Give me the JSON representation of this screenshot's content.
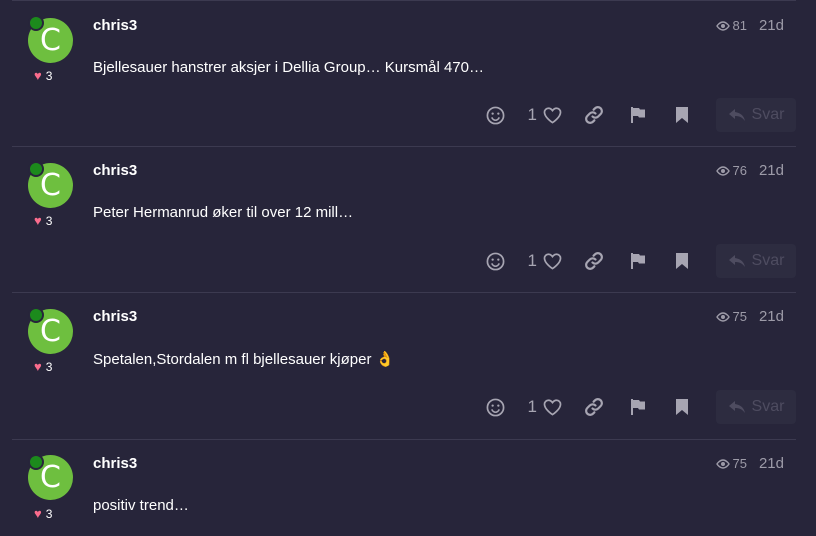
{
  "posts": [
    {
      "avatar_letter": "C",
      "username": "chris3",
      "like_count": "3",
      "views": "81",
      "age": "21d",
      "text": "Bjellesauer hanstrer aksjer i Dellia Group… Kursmål 470…",
      "post_likes": "1",
      "reply_label": "Svar"
    },
    {
      "avatar_letter": "C",
      "username": "chris3",
      "like_count": "3",
      "views": "76",
      "age": "21d",
      "text": "Peter Hermanrud øker til over 12 mill…",
      "post_likes": "1",
      "reply_label": "Svar"
    },
    {
      "avatar_letter": "C",
      "username": "chris3",
      "like_count": "3",
      "views": "75",
      "age": "21d",
      "text": "Spetalen,Stordalen m fl bjellesauer kjøper 👌",
      "post_likes": "1",
      "reply_label": "Svar"
    },
    {
      "avatar_letter": "C",
      "username": "chris3",
      "like_count": "3",
      "views": "75",
      "age": "21d",
      "text": "positiv trend…"
    }
  ],
  "colors": {
    "background": "#27253a",
    "avatar": "#6ebf3f",
    "online": "#1c8a1c",
    "heart": "#fa6c8d",
    "muted": "#9d9ba8"
  },
  "icons": [
    "eye-icon",
    "smiley-icon",
    "heart-outline-icon",
    "link-icon",
    "flag-icon",
    "bookmark-icon",
    "reply-arrow-icon",
    "heart-icon"
  ]
}
